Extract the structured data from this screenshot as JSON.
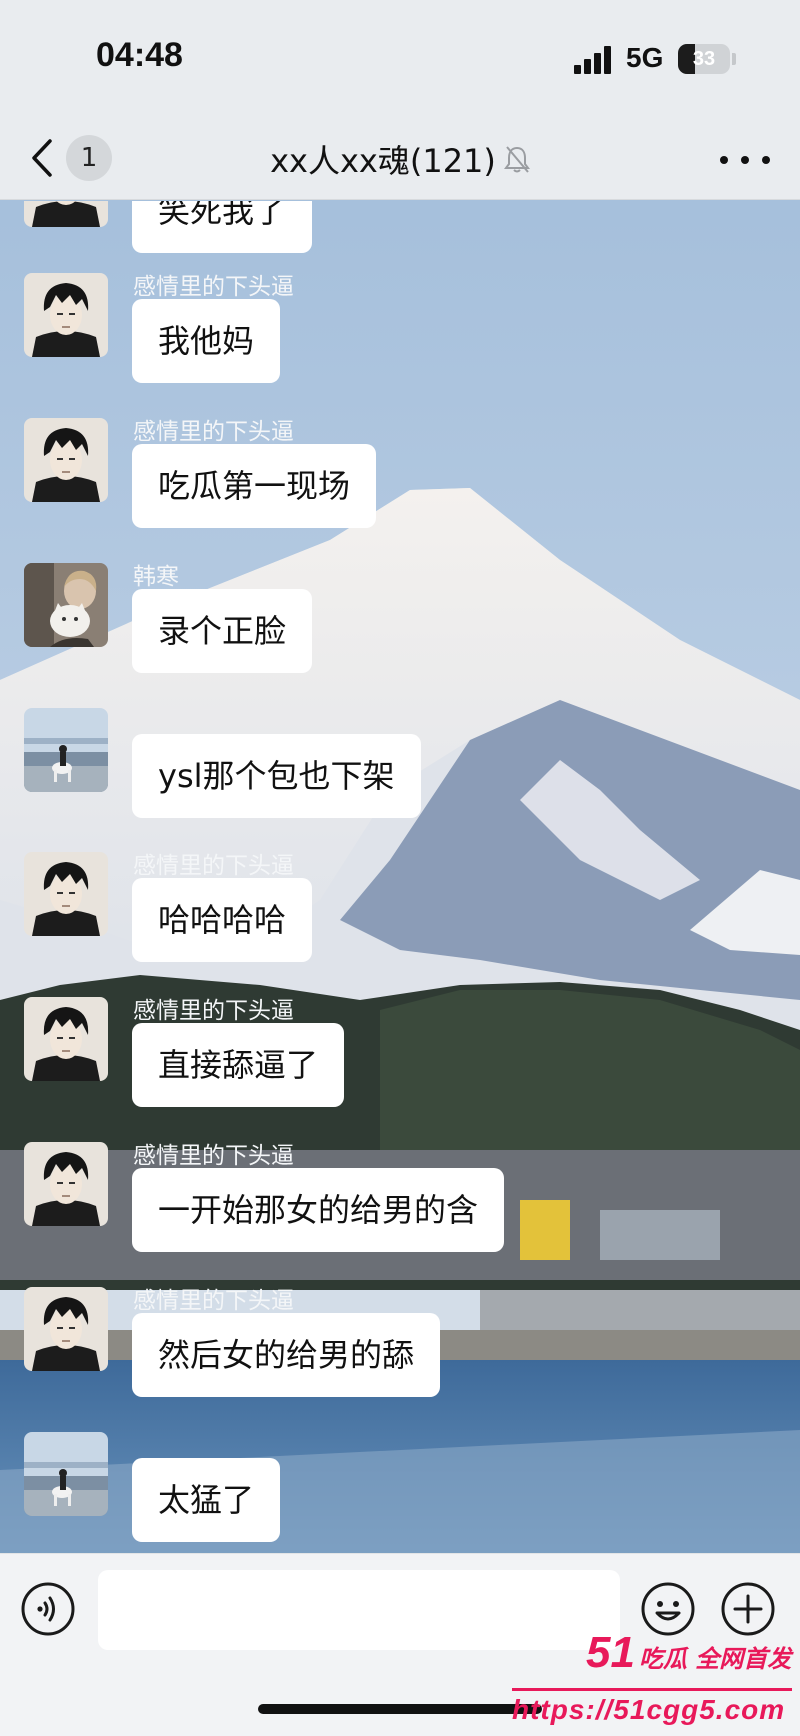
{
  "status_bar": {
    "time": "04:48",
    "network": "5G",
    "battery_level": "33",
    "battery_fraction": 0.33
  },
  "nav": {
    "unread_count": "1",
    "title": "xx人xx魂(121)",
    "muted": true
  },
  "messages": [
    {
      "sender": "",
      "avatar": "anime-boy",
      "text": "笑死我了",
      "partial": true
    },
    {
      "sender": "感情里的下头逼",
      "avatar": "anime-boy",
      "text": "我他妈"
    },
    {
      "sender": "感情里的下头逼",
      "avatar": "anime-boy",
      "text": "吃瓜第一现场"
    },
    {
      "sender": "韩寒",
      "avatar": "person-with-cat",
      "text": "录个正脸"
    },
    {
      "sender": "",
      "avatar": "beach-rider",
      "text": "ysl那个包也下架"
    },
    {
      "sender": "感情里的下头逼",
      "avatar": "anime-boy",
      "text": "哈哈哈哈"
    },
    {
      "sender": "感情里的下头逼",
      "avatar": "anime-boy",
      "text": "直接舔逼了"
    },
    {
      "sender": "感情里的下头逼",
      "avatar": "anime-boy",
      "text": "一开始那女的给男的含"
    },
    {
      "sender": "感情里的下头逼",
      "avatar": "anime-boy",
      "text": "然后女的给男的舔"
    },
    {
      "sender": "",
      "avatar": "beach-rider",
      "text": "太猛了"
    }
  ],
  "input": {
    "value": "",
    "placeholder": ""
  },
  "watermark": {
    "number": "51",
    "text": "吃瓜 全网首发",
    "url": "https://51cgg5.com"
  },
  "colors": {
    "watermark": "#e8195a",
    "bubble": "#ffffff",
    "bar": "#e9ecef"
  }
}
